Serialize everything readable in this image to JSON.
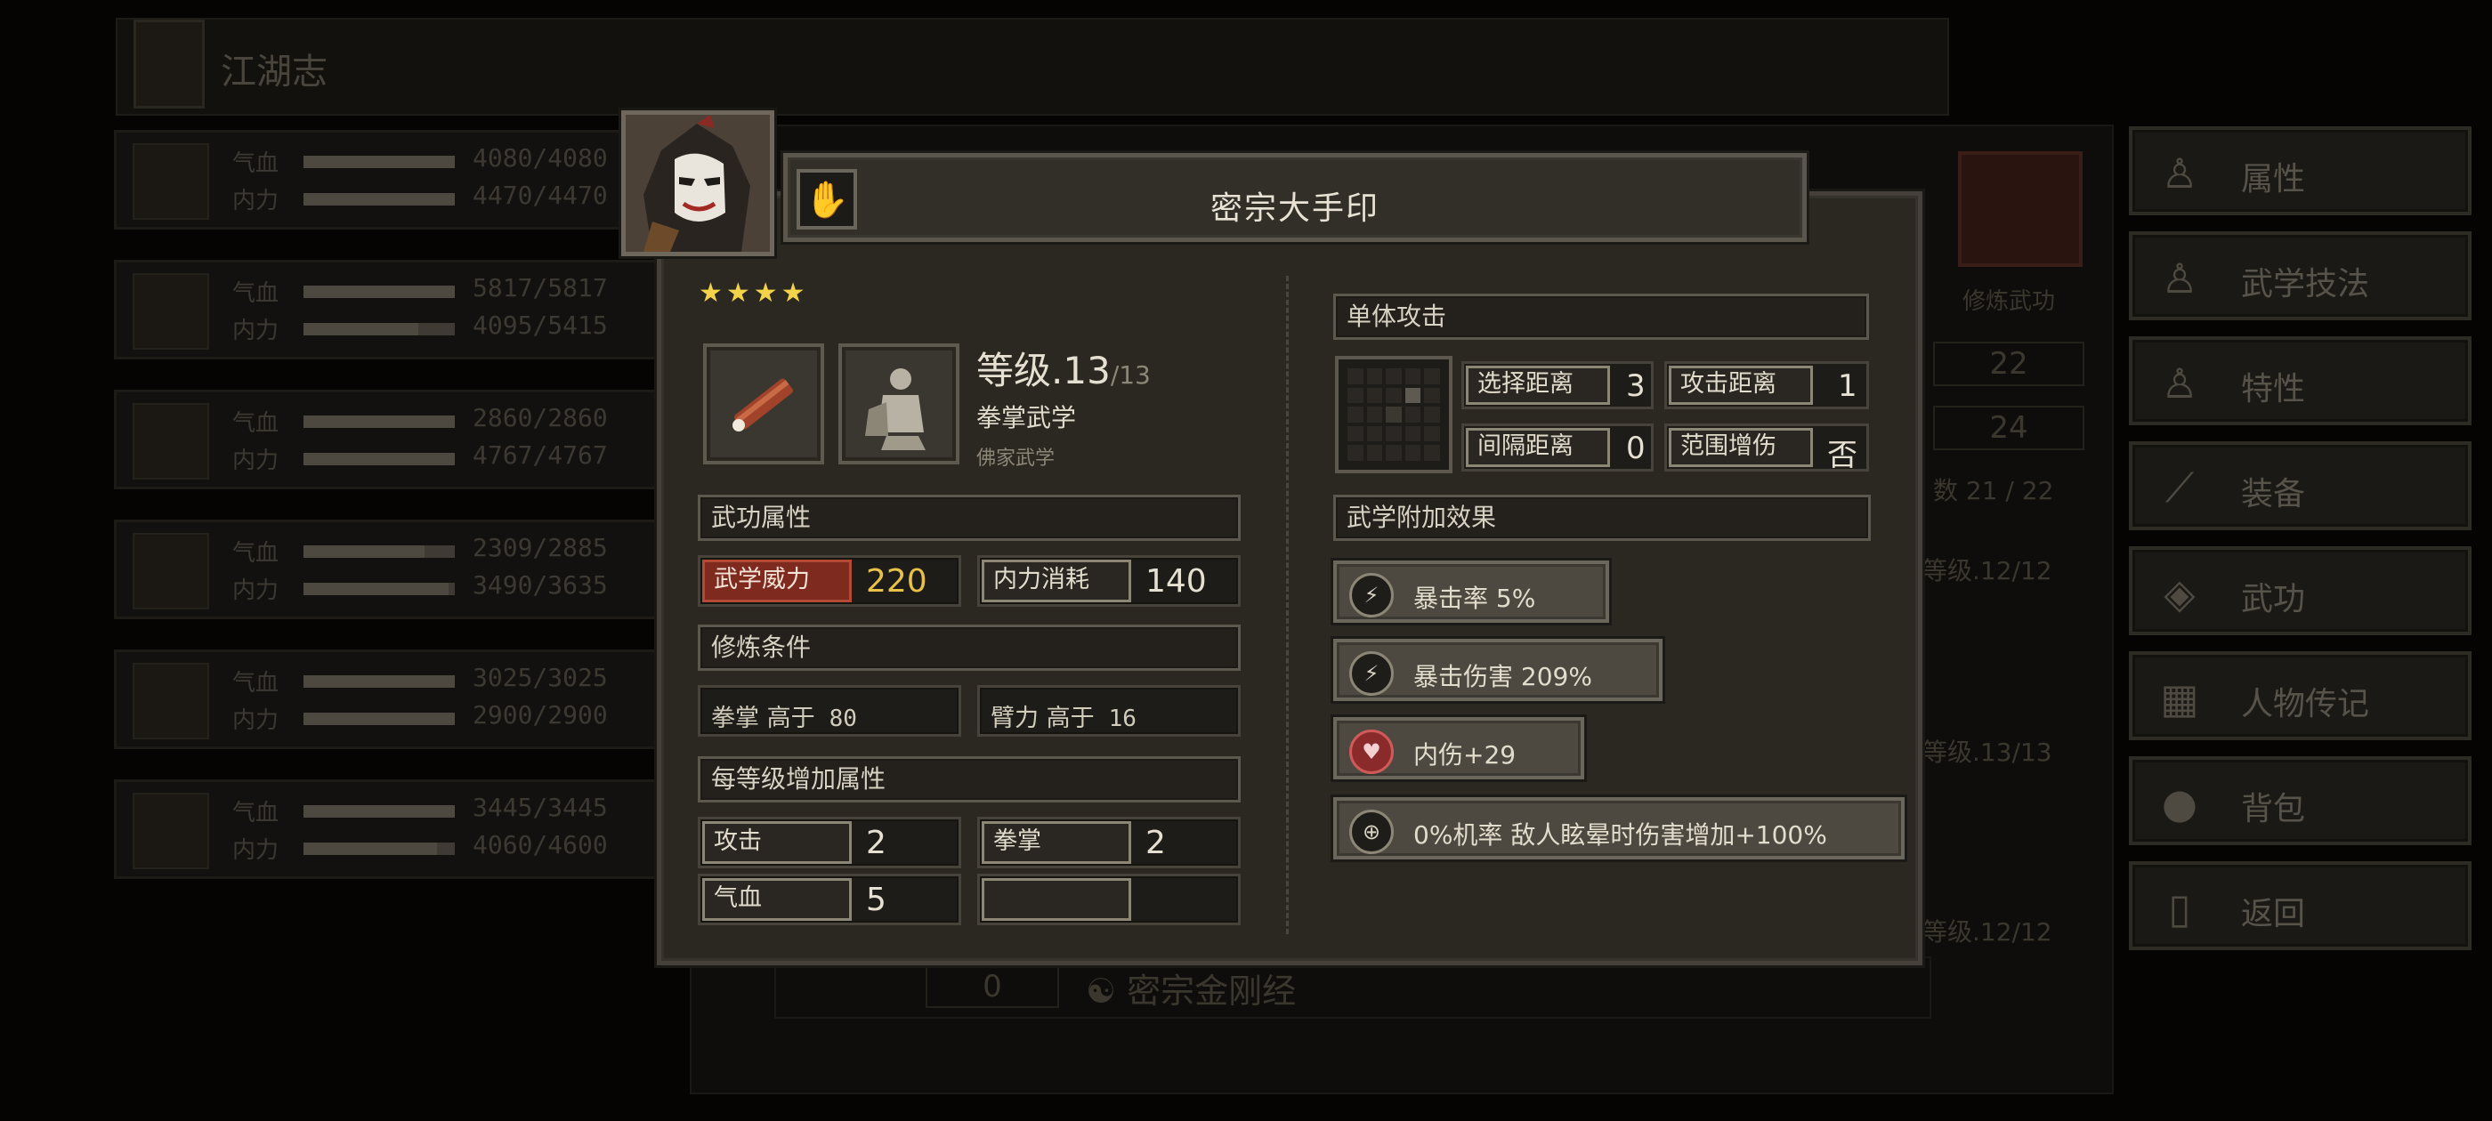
{
  "background": {
    "page_title": "江湖志",
    "party": [
      {
        "hp_label": "气血",
        "mp_label": "内力",
        "hp": "4080/4080",
        "mp": "4470/4470",
        "hp_frac": 1.0,
        "mp_frac": 1.0
      },
      {
        "hp_label": "气血",
        "mp_label": "内力",
        "hp": "5817/5817",
        "mp": "4095/5415",
        "hp_frac": 1.0,
        "mp_frac": 0.76
      },
      {
        "hp_label": "气血",
        "mp_label": "内力",
        "hp": "2860/2860",
        "mp": "4767/4767",
        "hp_frac": 1.0,
        "mp_frac": 1.0
      },
      {
        "hp_label": "气血",
        "mp_label": "内力",
        "hp": "2309/2885",
        "mp": "3490/3635",
        "hp_frac": 0.8,
        "mp_frac": 0.96
      },
      {
        "hp_label": "气血",
        "mp_label": "内力",
        "hp": "3025/3025",
        "mp": "2900/2900",
        "hp_frac": 1.0,
        "mp_frac": 1.0
      },
      {
        "hp_label": "气血",
        "mp_label": "内力",
        "hp": "3445/3445",
        "mp": "4060/4600",
        "hp_frac": 1.0,
        "mp_frac": 0.88
      }
    ],
    "side_label": "修炼武功",
    "stat_box_1": "22",
    "stat_box_2": "24",
    "count": "数 21 / 22",
    "levels": [
      "等级.12/12",
      "等级.13/13",
      "等级.12/12"
    ],
    "bottom_num": "0",
    "bottom_skill": "密宗金刚经"
  },
  "menu": [
    {
      "label": "属性",
      "icon": "person-icon"
    },
    {
      "label": "武学技法",
      "icon": "martial-technique-icon"
    },
    {
      "label": "特性",
      "icon": "trait-icon"
    },
    {
      "label": "装备",
      "icon": "sword-icon"
    },
    {
      "label": "武功",
      "icon": "skill-book-icon"
    },
    {
      "label": "人物传记",
      "icon": "biography-icon"
    },
    {
      "label": "背包",
      "icon": "bag-icon"
    },
    {
      "label": "返回",
      "icon": "door-icon"
    }
  ],
  "skill": {
    "name": "密宗大手印",
    "stars": "★★★★",
    "star_count": 4,
    "level_label": "等级.",
    "level": "13",
    "level_max": "/13",
    "type": "拳掌武学",
    "school": "佛家武学",
    "attributes_title": "武功属性",
    "power_label": "武学威力",
    "power_value": "220",
    "cost_label": "内力消耗",
    "cost_value": "140",
    "requirements_title": "修炼条件",
    "req1": "拳掌 高于",
    "req1_val": "80",
    "req2": "臂力 高于",
    "req2_val": "16",
    "per_level_title": "每等级增加属性",
    "pl1_label": "攻击",
    "pl1_value": "2",
    "pl2_label": "拳掌",
    "pl2_value": "2",
    "pl3_label": "气血",
    "pl3_value": "5",
    "target_type": "单体攻击",
    "select_range_label": "选择距离",
    "select_range": "3",
    "attack_range_label": "攻击距离",
    "attack_range": "1",
    "gap_range_label": "间隔距离",
    "gap_range": "0",
    "aoe_bonus_label": "范围增伤",
    "aoe_bonus": "否",
    "effects_title": "武学附加效果",
    "effects": [
      {
        "text": "暴击率 5%",
        "icon": "lightning-icon"
      },
      {
        "text": "暴击伤害 209%",
        "icon": "lightning-icon"
      },
      {
        "text": "内伤+29",
        "icon": "broken-heart-icon"
      },
      {
        "text": "0%机率 敌人眩晕时伤害增加+100%",
        "icon": "target-icon"
      }
    ]
  }
}
